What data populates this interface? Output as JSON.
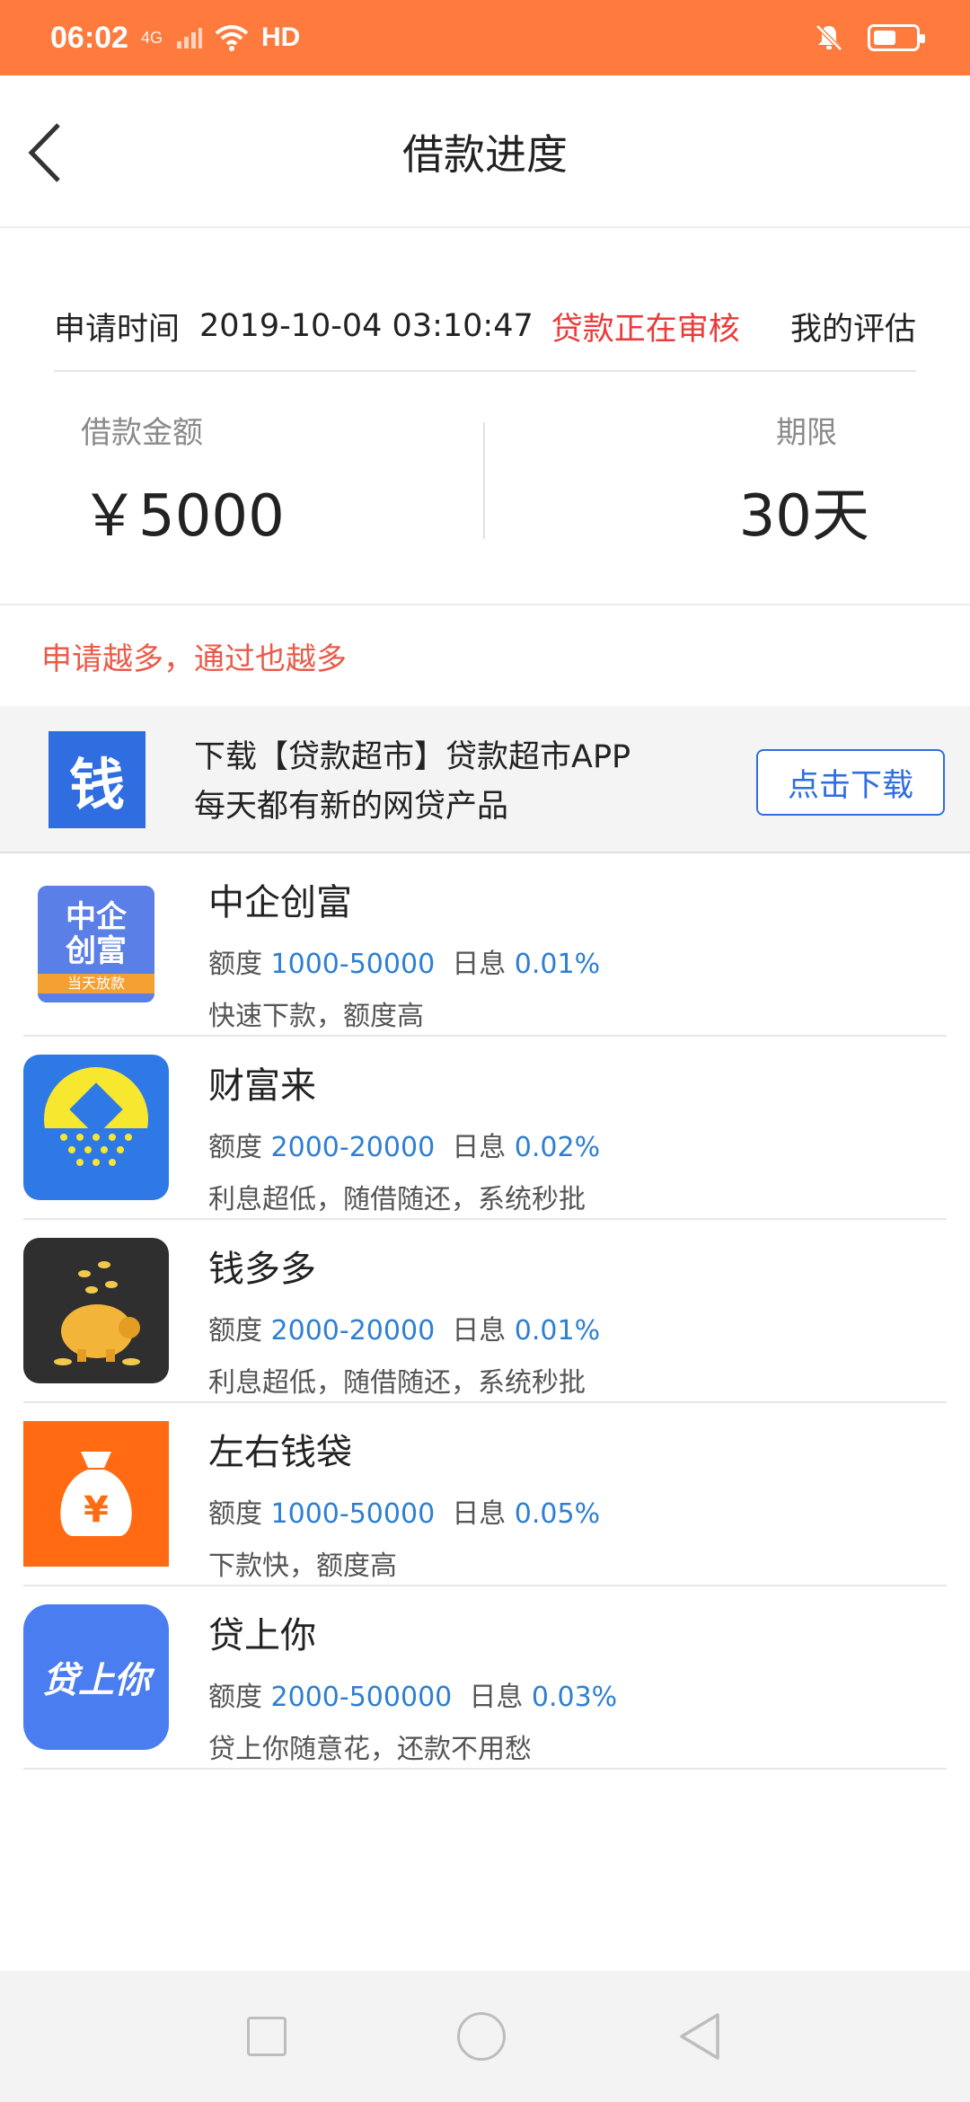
{
  "status_bar": {
    "time": "06:02",
    "network": "4G",
    "hd": "HD"
  },
  "nav": {
    "title": "借款进度"
  },
  "application": {
    "time_label": "申请时间",
    "time_value": "2019-10-04 03:10:47",
    "status": "贷款正在审核",
    "eval_link": "我的评估",
    "amount_label": "借款金额",
    "amount_value": "￥5000",
    "term_label": "期限",
    "term_value": "30天"
  },
  "promo": {
    "text": "申请越多，通过也越多"
  },
  "banner": {
    "logo_char": "钱",
    "line1": "下载【贷款超市】贷款超市APP",
    "line2": "每天都有新的网贷产品",
    "button": "点击下载"
  },
  "products": [
    {
      "name": "中企创富",
      "amount_label": "额度",
      "amount": "1000-50000",
      "rate_label": "日息",
      "rate": "0.01%",
      "desc": "快速下款，额度高",
      "logo_line1": "中企",
      "logo_line2": "创富",
      "logo_tag": "当天放款"
    },
    {
      "name": "财富来",
      "amount_label": "额度",
      "amount": "2000-20000",
      "rate_label": "日息",
      "rate": "0.02%",
      "desc": "利息超低，随借随还，系统秒批"
    },
    {
      "name": "钱多多",
      "amount_label": "额度",
      "amount": "2000-20000",
      "rate_label": "日息",
      "rate": "0.01%",
      "desc": "利息超低，随借随还，系统秒批"
    },
    {
      "name": "左右钱袋",
      "amount_label": "额度",
      "amount": "1000-50000",
      "rate_label": "日息",
      "rate": "0.05%",
      "desc": "下款快，额度高",
      "logo_char": "¥"
    },
    {
      "name": "贷上你",
      "amount_label": "额度",
      "amount": "2000-500000",
      "rate_label": "日息",
      "rate": "0.03%",
      "desc": "贷上你随意花，还款不用愁",
      "logo_text": "贷上你"
    }
  ],
  "colors": {
    "status_bar": "#ff7a3d",
    "status_red": "#ea3b3b",
    "accent_blue": "#2f6de1",
    "value_blue": "#2e7fd3"
  }
}
